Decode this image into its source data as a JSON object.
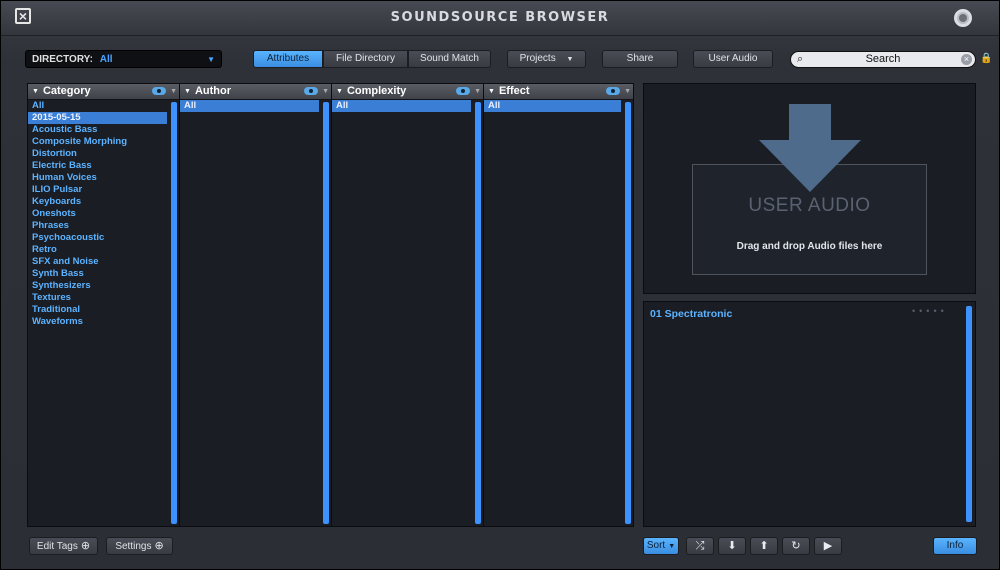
{
  "window": {
    "title": "SOUNDSOURCE BROWSER"
  },
  "toolbar": {
    "directory_label": "DIRECTORY:",
    "directory_value": "All",
    "tabs": [
      "Attributes",
      "File Directory",
      "Sound Match"
    ],
    "projects_label": "Projects",
    "share_label": "Share",
    "user_audio_label": "User Audio",
    "search_placeholder": "Search"
  },
  "columns": {
    "category": {
      "header": "Category",
      "items": [
        "All",
        "2015-05-15",
        "Acoustic Bass",
        "Composite Morphing",
        "Distortion",
        "Electric Bass",
        "Human Voices",
        "ILIO Pulsar",
        "Keyboards",
        "Oneshots",
        "Phrases",
        "Psychoacoustic",
        "Retro",
        "SFX and Noise",
        "Synth Bass",
        "Synthesizers",
        "Textures",
        "Traditional",
        "Waveforms"
      ],
      "selected": "2015-05-15"
    },
    "author": {
      "header": "Author",
      "items": [
        "All"
      ]
    },
    "complexity": {
      "header": "Complexity",
      "items": [
        "All"
      ]
    },
    "effect": {
      "header": "Effect",
      "items": [
        "All"
      ]
    }
  },
  "user_audio": {
    "title": "USER AUDIO",
    "subtitle": "Drag and drop Audio files here"
  },
  "results": {
    "items": [
      "01 Spectratronic"
    ]
  },
  "bottom": {
    "edit_tags_label": "Edit Tags",
    "settings_label": "Settings",
    "sort_label": "Sort",
    "info_label": "Info"
  },
  "colors": {
    "accent": "#3e92ff",
    "link": "#5cb3ff",
    "panel": "#1a1d24"
  }
}
